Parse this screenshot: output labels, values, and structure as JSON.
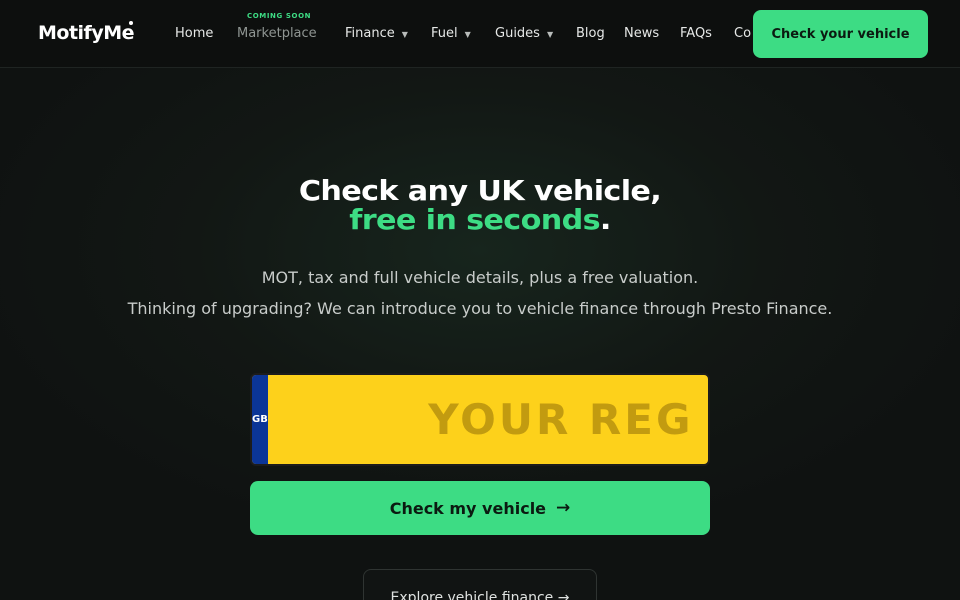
{
  "brand": {
    "logo_text": "MotifyMe"
  },
  "nav": {
    "items": [
      {
        "label": "Home",
        "has_dropdown": false
      },
      {
        "label": "Marketplace",
        "has_dropdown": false,
        "badge": "COMING SOON"
      },
      {
        "label": "Finance",
        "has_dropdown": true
      },
      {
        "label": "Fuel",
        "has_dropdown": true
      },
      {
        "label": "Guides",
        "has_dropdown": true
      },
      {
        "label": "Blog",
        "has_dropdown": false
      },
      {
        "label": "News",
        "has_dropdown": false
      },
      {
        "label": "FAQs",
        "has_dropdown": false
      },
      {
        "label": "Co",
        "has_dropdown": false
      }
    ],
    "cta_label": "Check your vehicle"
  },
  "hero": {
    "title_line1": "Check any UK vehicle,",
    "title_accent": "free in seconds",
    "title_period": ".",
    "subtitle_line1": "MOT, tax and full vehicle details, plus a free valuation.",
    "subtitle_line2": "Thinking of upgrading? We can introduce you to vehicle finance through Presto Finance."
  },
  "plate": {
    "country_code": "GB",
    "placeholder": "YOUR REG",
    "value": ""
  },
  "buttons": {
    "check_label": "Check my vehicle",
    "check_arrow": "→",
    "explore_label": "Explore vehicle finance →"
  },
  "colors": {
    "accent": "#3ddc84",
    "plate_yellow": "#fdd11b",
    "plate_blue": "#0b3597",
    "background": "#121714"
  }
}
